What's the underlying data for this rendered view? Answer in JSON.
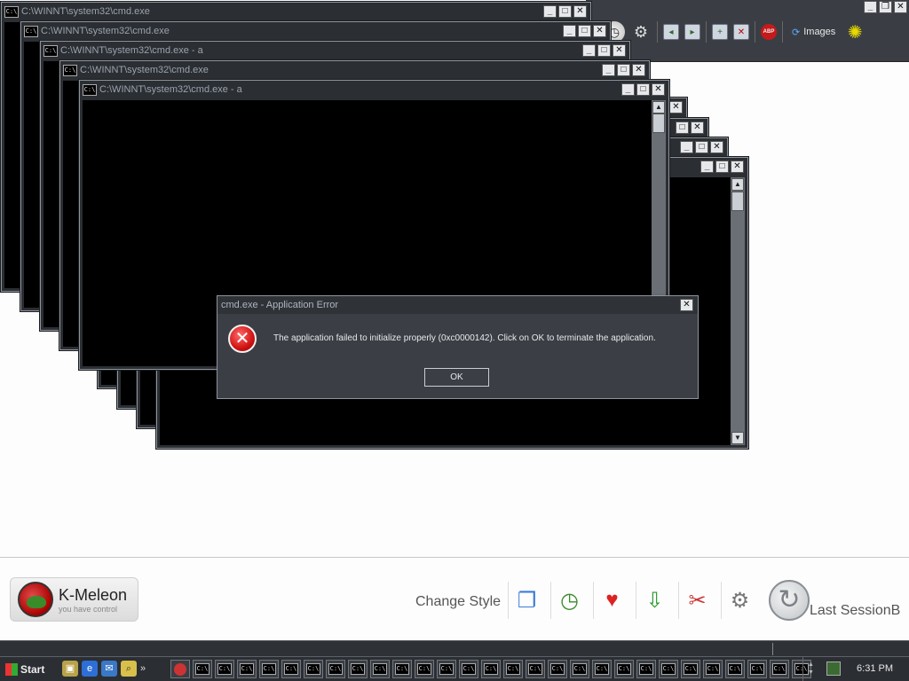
{
  "browser": {
    "images_label": "Images",
    "toolbar_icons": [
      "history-icon",
      "settings-icon",
      "back-icon",
      "forward-icon",
      "new-tab-icon",
      "close-tab-icon",
      "adblock-icon",
      "images-icon",
      "kaleidoscope-icon"
    ],
    "adblock_label": "ABP"
  },
  "cmd_windows": [
    {
      "title": "C:\\WINNT\\system32\\cmd.exe"
    },
    {
      "title": "C:\\WINNT\\system32\\cmd.exe"
    },
    {
      "title": "C:\\WINNT\\system32\\cmd.exe - a"
    },
    {
      "title": "C:\\WINNT\\system32\\cmd.exe"
    },
    {
      "title": "C:\\WINNT\\system32\\cmd.exe - a"
    }
  ],
  "cmd_icon_text": "C:\\",
  "error_dialog": {
    "title": "cmd.exe - Application Error",
    "message": "The application failed to initialize properly (0xc0000142). Click on OK to terminate the application.",
    "ok_label": "OK",
    "icon": "error-icon"
  },
  "kmeleon": {
    "logo_name": "K-Meleon",
    "logo_tagline": "you have control",
    "change_style_label": "Change Style",
    "tools": [
      "new-window-icon",
      "clock-icon",
      "favorites-heart-icon",
      "download-icon",
      "tools-icon",
      "privacy-icon"
    ],
    "last_session_label": "Last SessionB"
  },
  "taskbar": {
    "start_label": "Start",
    "quicklaunch": [
      "show-desktop-icon",
      "ie-icon",
      "outlook-icon",
      "search-icon"
    ],
    "more_label": "»",
    "task_count": 28,
    "clock": "6:31 PM"
  },
  "colors": {
    "window_frame": "#2b2e33",
    "console_bg": "#000000",
    "dialog_bg": "#3b3f45",
    "error_red": "#d11313"
  }
}
